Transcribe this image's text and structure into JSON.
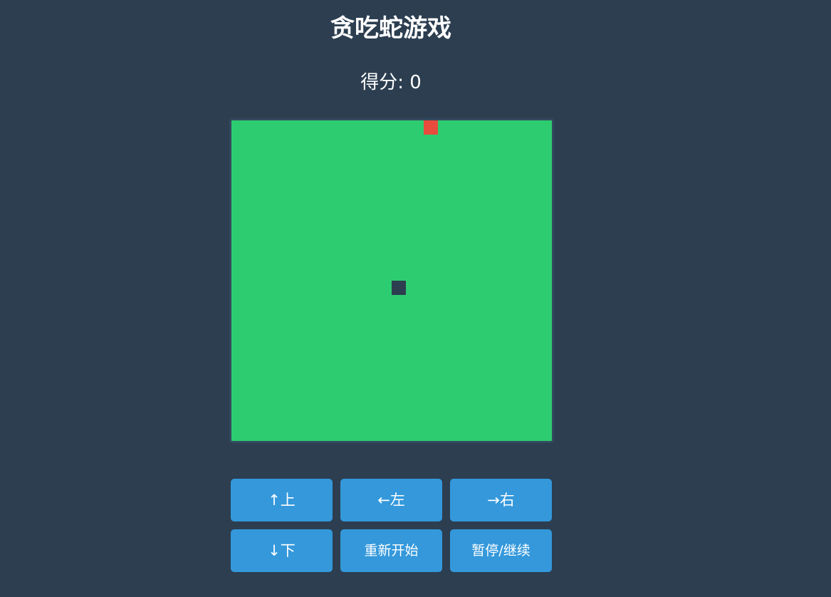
{
  "title": "贪吃蛇游戏",
  "score": {
    "label": "得分: 0",
    "value": 0
  },
  "board": {
    "columns": 20,
    "rows": 20,
    "snake": [
      [
        10,
        10
      ]
    ],
    "food": [
      12,
      0
    ]
  },
  "controls": {
    "up": "↑上",
    "left": "←左",
    "right": "→右",
    "down": "↓下",
    "restart": "重新开始",
    "pause": "暂停/继续"
  },
  "colors": {
    "background": "#2c3e50",
    "board": "#2ecc71",
    "board_border": "#34495e",
    "snake": "#2c3e50",
    "food": "#e74c3c",
    "button": "#3498db",
    "text": "#ffffff"
  }
}
